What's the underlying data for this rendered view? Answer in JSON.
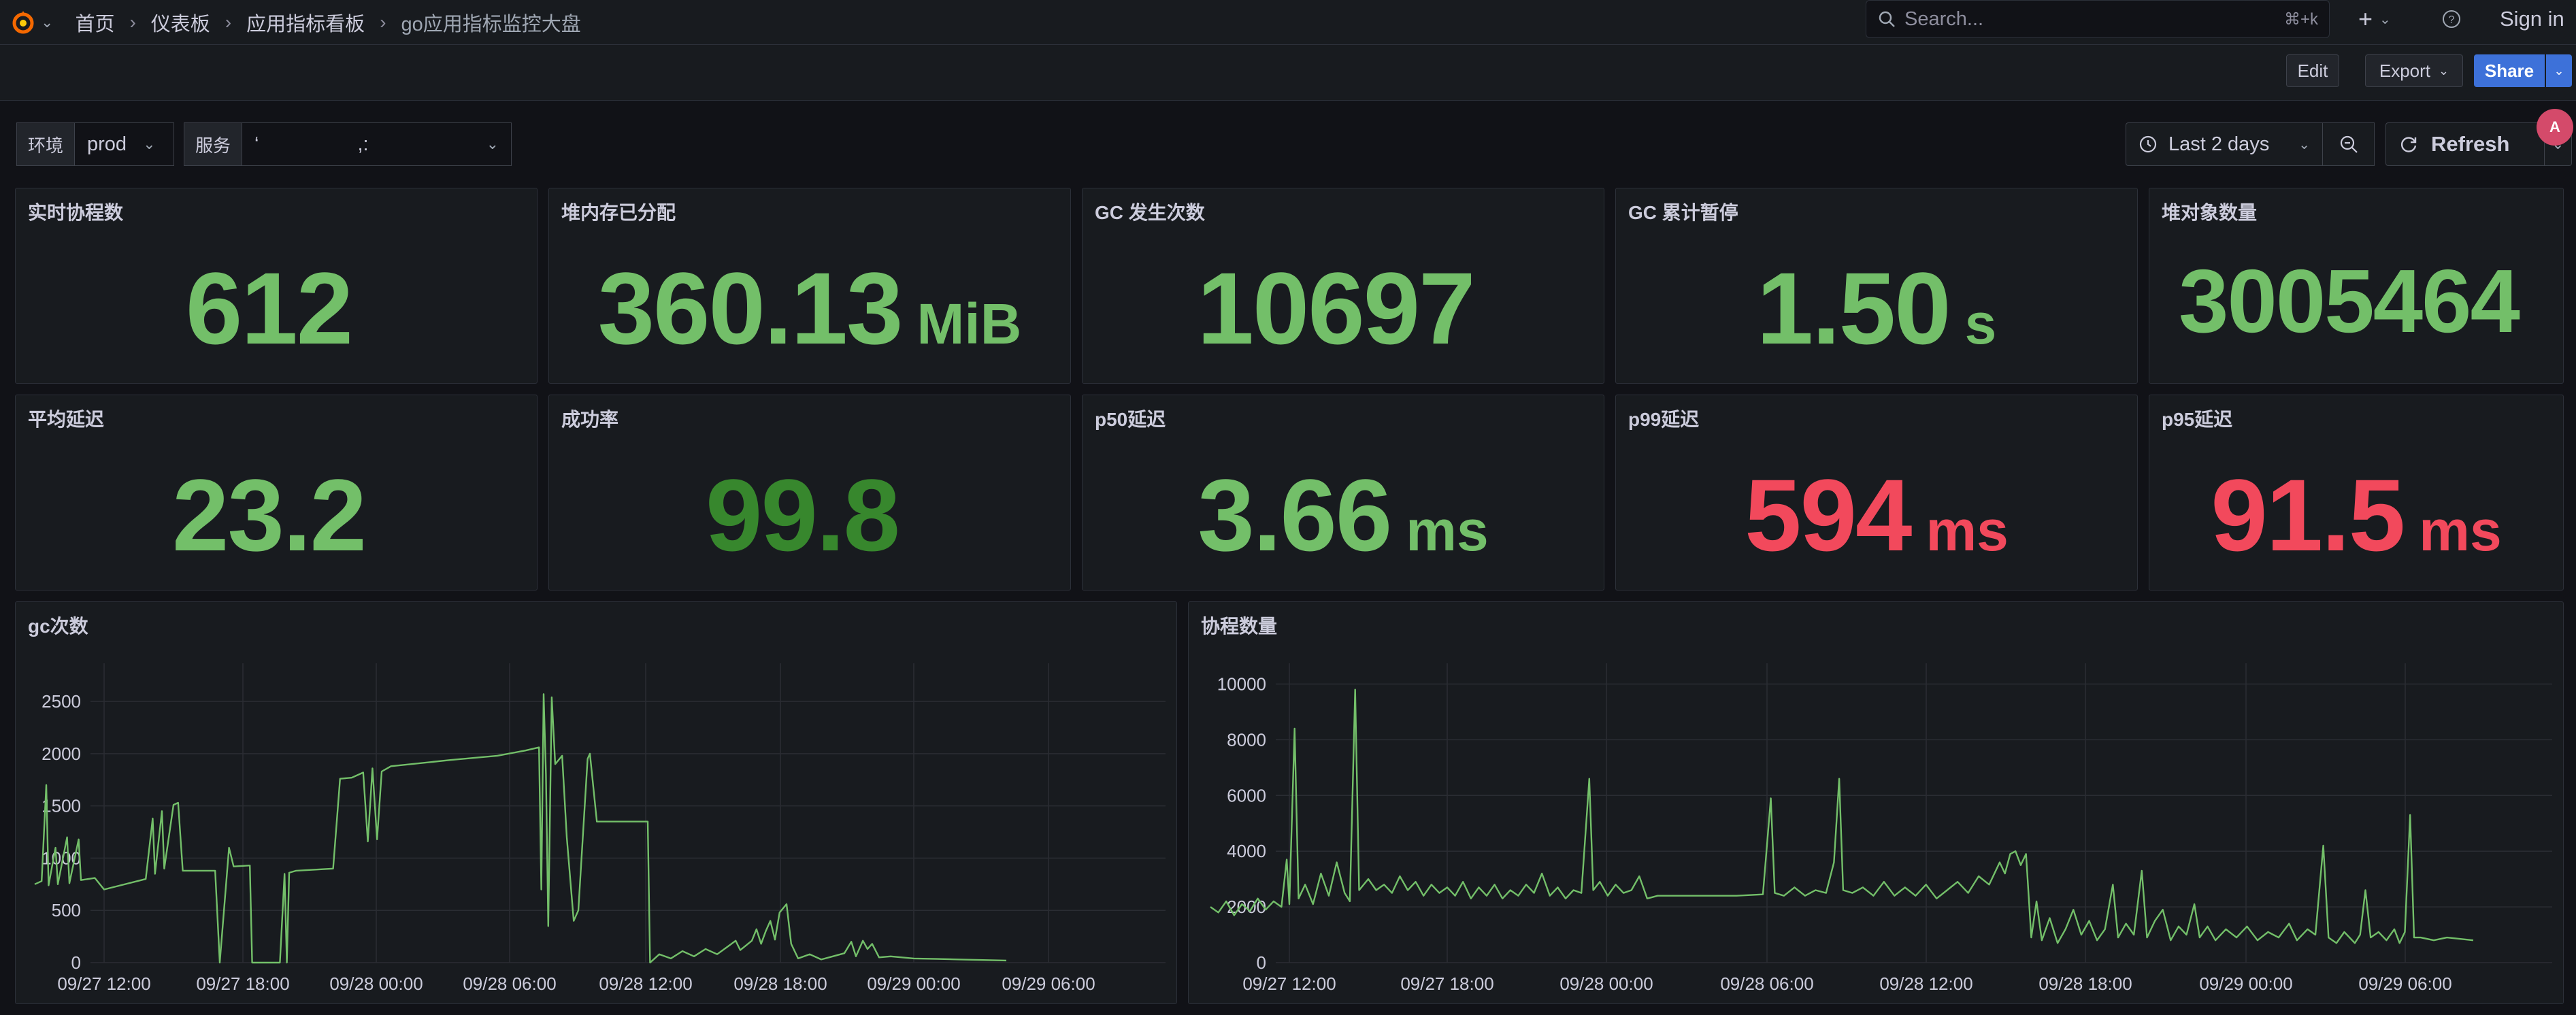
{
  "breadcrumb": [
    "首页",
    "仪表板",
    "应用指标看板",
    "go应用指标监控大盘"
  ],
  "search": {
    "placeholder": "Search...",
    "shortcut": "⌘+k"
  },
  "header": {
    "signin": "Sign in"
  },
  "toolbar": {
    "edit": "Edit",
    "export": "Export",
    "share": "Share"
  },
  "variables": [
    {
      "label": "环境",
      "value": "prod"
    },
    {
      "label": "服务",
      "value": "‘                  ,:"
    }
  ],
  "timepicker": {
    "range": "Last 2 days",
    "refresh": "Refresh"
  },
  "translate_badge": "A",
  "stats": [
    {
      "title": "实时协程数",
      "value": "612",
      "unit": "",
      "color": "#73bf69"
    },
    {
      "title": "堆内存已分配",
      "value": "360.13",
      "unit": "MiB",
      "color": "#73bf69"
    },
    {
      "title": "GC 发生次数",
      "value": "10697",
      "unit": "",
      "color": "#73bf69"
    },
    {
      "title": "GC 累计暂停",
      "value": "1.50",
      "unit": "s",
      "color": "#73bf69"
    },
    {
      "title": "堆对象数量",
      "value": "3005464",
      "unit": "",
      "color": "#73bf69"
    },
    {
      "title": "平均延迟",
      "value": "23.2",
      "unit": "",
      "color": "#73bf69"
    },
    {
      "title": "成功率",
      "value": "99.8",
      "unit": "",
      "color": "#37872d"
    },
    {
      "title": "p50延迟",
      "value": "3.66",
      "unit": "ms",
      "color": "#73bf69"
    },
    {
      "title": "p99延迟",
      "value": "594",
      "unit": "ms",
      "color": "#f2495c"
    },
    {
      "title": "p95延迟",
      "value": "91.5",
      "unit": "ms",
      "color": "#f2495c"
    }
  ],
  "charts": {
    "gc": {
      "title": "gc次数"
    },
    "goroutines": {
      "title": "协程数量"
    }
  },
  "chart_data": [
    {
      "type": "line",
      "title": "gc次数",
      "x_start": "09/27 09:00",
      "xticks": [
        "09/27 12:00",
        "09/27 18:00",
        "09/28 00:00",
        "09/28 06:00",
        "09/28 12:00",
        "09/28 18:00",
        "09/29 00:00",
        "09/29 06:00"
      ],
      "yticks": [
        0,
        500,
        1000,
        1500,
        2000,
        2500
      ],
      "ylim": [
        0,
        2800
      ],
      "xlim_hours": [
        0,
        48
      ],
      "grid": true,
      "series": [
        {
          "color": "#73bf69",
          "points": [
            [
              0.0,
              750
            ],
            [
              0.3,
              780
            ],
            [
              0.5,
              1700
            ],
            [
              0.6,
              740
            ],
            [
              0.9,
              1100
            ],
            [
              1.0,
              750
            ],
            [
              1.4,
              1200
            ],
            [
              1.5,
              760
            ],
            [
              1.9,
              1180
            ],
            [
              2.0,
              790
            ],
            [
              2.6,
              810
            ],
            [
              3.0,
              700
            ],
            [
              4.8,
              800
            ],
            [
              5.1,
              1380
            ],
            [
              5.2,
              850
            ],
            [
              5.5,
              1450
            ],
            [
              5.6,
              900
            ],
            [
              6.0,
              1510
            ],
            [
              6.2,
              1530
            ],
            [
              6.4,
              880
            ],
            [
              7.8,
              880
            ],
            [
              8.0,
              0
            ],
            [
              8.4,
              1100
            ],
            [
              8.6,
              920
            ],
            [
              9.3,
              930
            ],
            [
              9.4,
              0
            ],
            [
              10.6,
              0
            ],
            [
              10.8,
              850
            ],
            [
              10.9,
              0
            ],
            [
              11.0,
              860
            ],
            [
              11.3,
              880
            ],
            [
              12.9,
              900
            ],
            [
              13.2,
              1760
            ],
            [
              13.7,
              1770
            ],
            [
              14.0,
              1800
            ],
            [
              14.2,
              1820
            ],
            [
              14.4,
              1160
            ],
            [
              14.6,
              1860
            ],
            [
              14.8,
              1180
            ],
            [
              15.0,
              1830
            ],
            [
              15.4,
              1880
            ],
            [
              18.0,
              1940
            ],
            [
              20.0,
              1980
            ],
            [
              21.2,
              2030
            ],
            [
              21.8,
              2060
            ],
            [
              21.9,
              700
            ],
            [
              22.0,
              2570
            ],
            [
              22.1,
              1800
            ],
            [
              22.2,
              350
            ],
            [
              22.35,
              2540
            ],
            [
              22.5,
              1900
            ],
            [
              22.8,
              1980
            ],
            [
              23.0,
              1200
            ],
            [
              23.3,
              400
            ],
            [
              23.5,
              500
            ],
            [
              23.9,
              1950
            ],
            [
              24.0,
              2000
            ],
            [
              24.3,
              1350
            ],
            [
              26.5,
              1350
            ],
            [
              26.6,
              0
            ],
            [
              27.0,
              80
            ],
            [
              27.5,
              40
            ],
            [
              28.0,
              110
            ],
            [
              28.5,
              60
            ],
            [
              29.0,
              130
            ],
            [
              29.5,
              80
            ],
            [
              30.0,
              160
            ],
            [
              30.3,
              210
            ],
            [
              30.5,
              120
            ],
            [
              31.0,
              210
            ],
            [
              31.2,
              320
            ],
            [
              31.4,
              180
            ],
            [
              31.6,
              300
            ],
            [
              31.8,
              400
            ],
            [
              32.0,
              220
            ],
            [
              32.2,
              480
            ],
            [
              32.5,
              560
            ],
            [
              32.7,
              180
            ],
            [
              33.0,
              40
            ],
            [
              33.5,
              80
            ],
            [
              34.0,
              30
            ],
            [
              34.5,
              60
            ],
            [
              35.0,
              90
            ],
            [
              35.3,
              200
            ],
            [
              35.5,
              60
            ],
            [
              35.8,
              210
            ],
            [
              36.0,
              130
            ],
            [
              36.2,
              180
            ],
            [
              36.5,
              50
            ],
            [
              37.0,
              60
            ],
            [
              38.0,
              40
            ],
            [
              39.0,
              35
            ],
            [
              40.0,
              30
            ],
            [
              41.0,
              25
            ],
            [
              42.0,
              20
            ]
          ]
        }
      ]
    },
    {
      "type": "line",
      "title": "协程数量",
      "x_start": "09/27 09:00",
      "xticks": [
        "09/27 12:00",
        "09/27 18:00",
        "09/28 00:00",
        "09/28 06:00",
        "09/28 12:00",
        "09/28 18:00",
        "09/29 00:00",
        "09/29 06:00"
      ],
      "yticks": [
        0,
        2000,
        4000,
        6000,
        8000,
        10000
      ],
      "ylim": [
        0,
        10500
      ],
      "xlim_hours": [
        0,
        48
      ],
      "grid": true,
      "series": [
        {
          "color": "#73bf69",
          "points": [
            [
              0.0,
              2000
            ],
            [
              0.3,
              1800
            ],
            [
              0.6,
              2200
            ],
            [
              0.9,
              1700
            ],
            [
              1.2,
              2100
            ],
            [
              1.5,
              1850
            ],
            [
              1.8,
              2300
            ],
            [
              2.1,
              1900
            ],
            [
              2.4,
              2200
            ],
            [
              2.7,
              2000
            ],
            [
              2.9,
              3700
            ],
            [
              3.0,
              2100
            ],
            [
              3.2,
              8400
            ],
            [
              3.35,
              2300
            ],
            [
              3.6,
              2800
            ],
            [
              3.9,
              2100
            ],
            [
              4.2,
              3200
            ],
            [
              4.5,
              2400
            ],
            [
              4.8,
              3600
            ],
            [
              5.1,
              2500
            ],
            [
              5.3,
              2200
            ],
            [
              5.5,
              9800
            ],
            [
              5.65,
              2600
            ],
            [
              6.0,
              3000
            ],
            [
              6.3,
              2600
            ],
            [
              6.6,
              2800
            ],
            [
              6.9,
              2500
            ],
            [
              7.2,
              3100
            ],
            [
              7.5,
              2600
            ],
            [
              7.8,
              2900
            ],
            [
              8.1,
              2400
            ],
            [
              8.4,
              2800
            ],
            [
              8.7,
              2500
            ],
            [
              9.0,
              2700
            ],
            [
              9.3,
              2400
            ],
            [
              9.6,
              2900
            ],
            [
              9.9,
              2300
            ],
            [
              10.2,
              2700
            ],
            [
              10.5,
              2400
            ],
            [
              10.8,
              2800
            ],
            [
              11.1,
              2300
            ],
            [
              11.4,
              2600
            ],
            [
              11.7,
              2400
            ],
            [
              12.0,
              2800
            ],
            [
              12.3,
              2500
            ],
            [
              12.6,
              3200
            ],
            [
              12.9,
              2400
            ],
            [
              13.2,
              2700
            ],
            [
              13.5,
              2300
            ],
            [
              13.8,
              2600
            ],
            [
              14.1,
              2500
            ],
            [
              14.4,
              6600
            ],
            [
              14.55,
              2600
            ],
            [
              14.8,
              2900
            ],
            [
              15.1,
              2400
            ],
            [
              15.4,
              2800
            ],
            [
              15.7,
              2500
            ],
            [
              16.0,
              2600
            ],
            [
              16.3,
              3100
            ],
            [
              16.6,
              2300
            ],
            [
              17.0,
              2400
            ],
            [
              18.0,
              2400
            ],
            [
              19.0,
              2400
            ],
            [
              20.0,
              2400
            ],
            [
              21.0,
              2450
            ],
            [
              21.3,
              5900
            ],
            [
              21.45,
              2500
            ],
            [
              21.8,
              2400
            ],
            [
              22.2,
              2700
            ],
            [
              22.6,
              2400
            ],
            [
              23.0,
              2600
            ],
            [
              23.4,
              2500
            ],
            [
              23.7,
              3600
            ],
            [
              23.9,
              6600
            ],
            [
              24.05,
              2600
            ],
            [
              24.4,
              2500
            ],
            [
              24.8,
              2700
            ],
            [
              25.2,
              2400
            ],
            [
              25.6,
              2900
            ],
            [
              26.0,
              2400
            ],
            [
              26.4,
              2700
            ],
            [
              26.8,
              2400
            ],
            [
              27.2,
              2800
            ],
            [
              27.6,
              2300
            ],
            [
              28.0,
              2600
            ],
            [
              28.4,
              2900
            ],
            [
              28.8,
              2500
            ],
            [
              29.2,
              3100
            ],
            [
              29.6,
              2800
            ],
            [
              30.0,
              3600
            ],
            [
              30.2,
              3200
            ],
            [
              30.4,
              3900
            ],
            [
              30.6,
              4000
            ],
            [
              30.8,
              3500
            ],
            [
              31.0,
              3900
            ],
            [
              31.2,
              900
            ],
            [
              31.4,
              2200
            ],
            [
              31.6,
              800
            ],
            [
              31.9,
              1600
            ],
            [
              32.2,
              700
            ],
            [
              32.5,
              1200
            ],
            [
              32.8,
              1900
            ],
            [
              33.1,
              1000
            ],
            [
              33.4,
              1500
            ],
            [
              33.7,
              800
            ],
            [
              34.0,
              1200
            ],
            [
              34.3,
              2800
            ],
            [
              34.5,
              900
            ],
            [
              34.8,
              1400
            ],
            [
              35.1,
              1000
            ],
            [
              35.4,
              3300
            ],
            [
              35.6,
              900
            ],
            [
              35.9,
              1500
            ],
            [
              36.2,
              1900
            ],
            [
              36.5,
              800
            ],
            [
              36.8,
              1300
            ],
            [
              37.1,
              1000
            ],
            [
              37.4,
              2100
            ],
            [
              37.6,
              900
            ],
            [
              37.9,
              1300
            ],
            [
              38.2,
              800
            ],
            [
              38.6,
              1200
            ],
            [
              39.0,
              900
            ],
            [
              39.4,
              1300
            ],
            [
              39.8,
              800
            ],
            [
              40.2,
              1100
            ],
            [
              40.6,
              900
            ],
            [
              41.0,
              1400
            ],
            [
              41.3,
              800
            ],
            [
              41.7,
              1200
            ],
            [
              42.0,
              1000
            ],
            [
              42.3,
              4200
            ],
            [
              42.5,
              900
            ],
            [
              42.8,
              700
            ],
            [
              43.1,
              1100
            ],
            [
              43.5,
              700
            ],
            [
              43.7,
              1000
            ],
            [
              43.9,
              2600
            ],
            [
              44.1,
              900
            ],
            [
              44.4,
              1100
            ],
            [
              44.7,
              800
            ],
            [
              45.0,
              1200
            ],
            [
              45.2,
              700
            ],
            [
              45.4,
              1100
            ],
            [
              45.6,
              5300
            ],
            [
              45.75,
              900
            ],
            [
              46.0,
              900
            ],
            [
              46.5,
              800
            ],
            [
              47.0,
              900
            ],
            [
              48.0,
              800
            ]
          ]
        }
      ]
    }
  ]
}
